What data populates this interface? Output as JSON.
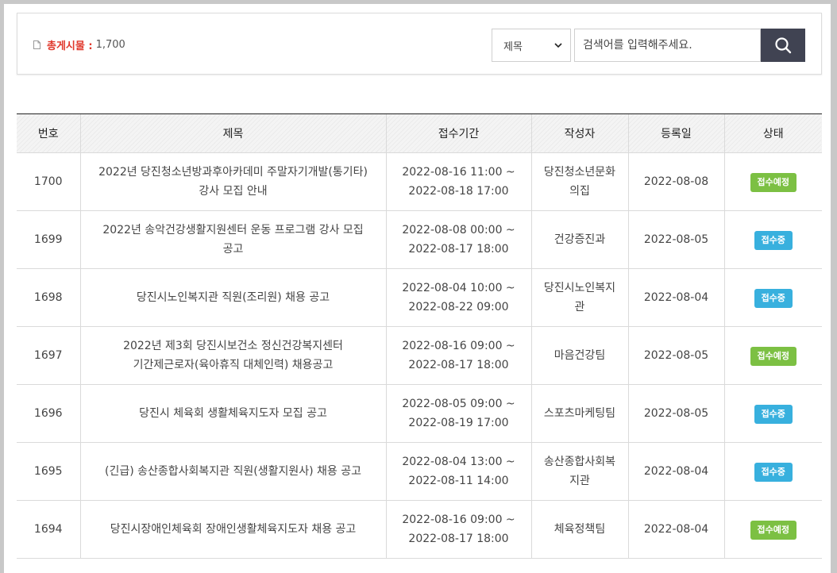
{
  "summary": {
    "total_label": "총게시물 :",
    "total_count": "1,700"
  },
  "search": {
    "field_option": "제목",
    "placeholder": "검색어를 입력해주세요."
  },
  "table": {
    "headers": [
      "번호",
      "제목",
      "접수기간",
      "작성자",
      "등록일",
      "상태"
    ],
    "rows": [
      {
        "no": "1700",
        "title_l1": "2022년 당진청소년방과후아카데미 주말자기개발(통기타)",
        "title_l2": "강사 모집 안내",
        "period_start": "2022-08-16 11:00 ~",
        "period_end": "2022-08-18 17:00",
        "author_l1": "당진청소년문화",
        "author_l2": "의집",
        "date": "2022-08-08",
        "status": "접수예정",
        "status_color": "#7cc043"
      },
      {
        "no": "1699",
        "title_l1": "2022년 송악건강생활지원센터 운동 프로그램 강사 모집",
        "title_l2": "공고",
        "period_start": "2022-08-08 00:00 ~",
        "period_end": "2022-08-17 18:00",
        "author_l1": "건강증진과",
        "author_l2": "",
        "date": "2022-08-05",
        "status": "접수중",
        "status_color": "#38b0de"
      },
      {
        "no": "1698",
        "title_l1": "당진시노인복지관 직원(조리원) 채용 공고",
        "title_l2": "",
        "period_start": "2022-08-04 10:00 ~",
        "period_end": "2022-08-22 09:00",
        "author_l1": "당진시노인복지",
        "author_l2": "관",
        "date": "2022-08-04",
        "status": "접수중",
        "status_color": "#38b0de"
      },
      {
        "no": "1697",
        "title_l1": "2022년 제3회 당진시보건소 정신건강복지센터",
        "title_l2": "기간제근로자(육아휴직 대체인력) 채용공고",
        "period_start": "2022-08-16 09:00 ~",
        "period_end": "2022-08-17 18:00",
        "author_l1": "마음건강팀",
        "author_l2": "",
        "date": "2022-08-05",
        "status": "접수예정",
        "status_color": "#7cc043"
      },
      {
        "no": "1696",
        "title_l1": "당진시 체육회 생활체육지도자 모집 공고",
        "title_l2": "",
        "period_start": "2022-08-05 09:00 ~",
        "period_end": "2022-08-19 17:00",
        "author_l1": "스포츠마케팅팀",
        "author_l2": "",
        "date": "2022-08-05",
        "status": "접수중",
        "status_color": "#38b0de"
      },
      {
        "no": "1695",
        "title_l1": "(긴급) 송산종합사회복지관 직원(생활지원사) 채용 공고",
        "title_l2": "",
        "period_start": "2022-08-04 13:00 ~",
        "period_end": "2022-08-11 14:00",
        "author_l1": "송산종합사회복",
        "author_l2": "지관",
        "date": "2022-08-04",
        "status": "접수중",
        "status_color": "#38b0de"
      },
      {
        "no": "1694",
        "title_l1": "당진시장애인체육회 장애인생활체육지도자 채용 공고",
        "title_l2": "",
        "period_start": "2022-08-16 09:00 ~",
        "period_end": "2022-08-17 18:00",
        "author_l1": "체육정책팀",
        "author_l2": "",
        "date": "2022-08-04",
        "status": "접수예정",
        "status_color": "#7cc043"
      }
    ]
  }
}
